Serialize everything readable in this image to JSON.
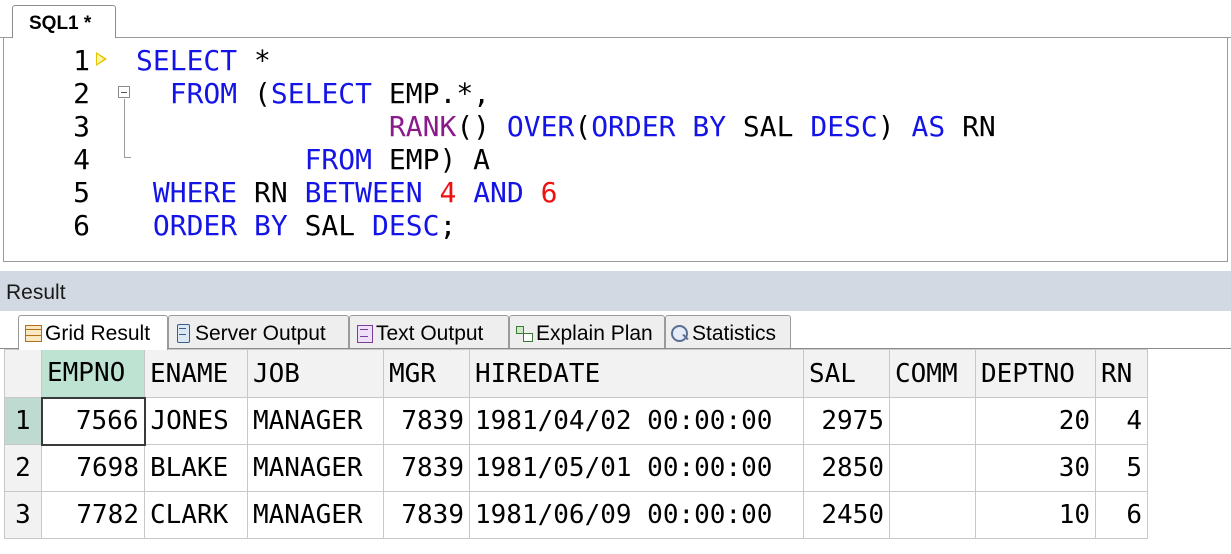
{
  "editor": {
    "tab_label": "SQL1 *",
    "line_numbers": [
      "1",
      "2",
      "3",
      "4",
      "5",
      "6"
    ]
  },
  "result": {
    "panel_title": "Result",
    "tabs": [
      {
        "label": "Grid Result",
        "icon": "grid-result-icon"
      },
      {
        "label": "Server Output",
        "icon": "server-output-icon"
      },
      {
        "label": "Text Output",
        "icon": "text-output-icon"
      },
      {
        "label": "Explain Plan",
        "icon": "explain-plan-icon"
      },
      {
        "label": "Statistics",
        "icon": "statistics-icon"
      }
    ],
    "grid": {
      "columns": [
        "EMPNO",
        "ENAME",
        "JOB",
        "MGR",
        "HIREDATE",
        "SAL",
        "COMM",
        "DEPTNO",
        "RN"
      ],
      "rows": [
        {
          "num": "1",
          "cells": [
            "7566",
            "JONES",
            "MANAGER",
            "7839",
            "1981/04/02 00:00:00",
            "2975",
            "",
            "20",
            "4"
          ]
        },
        {
          "num": "2",
          "cells": [
            "7698",
            "BLAKE",
            "MANAGER",
            "7839",
            "1981/05/01 00:00:00",
            "2850",
            "",
            "30",
            "5"
          ]
        },
        {
          "num": "3",
          "cells": [
            "7782",
            "CLARK",
            "MANAGER",
            "7839",
            "1981/06/09 00:00:00",
            "2450",
            "",
            "10",
            "6"
          ]
        }
      ]
    }
  },
  "colors": {
    "keyword": "#1414e6",
    "function": "#8b1a8b",
    "number_literal": "#ee1111",
    "header_bar": "#d2d9e2",
    "selected_column": "#bfe3d3"
  }
}
